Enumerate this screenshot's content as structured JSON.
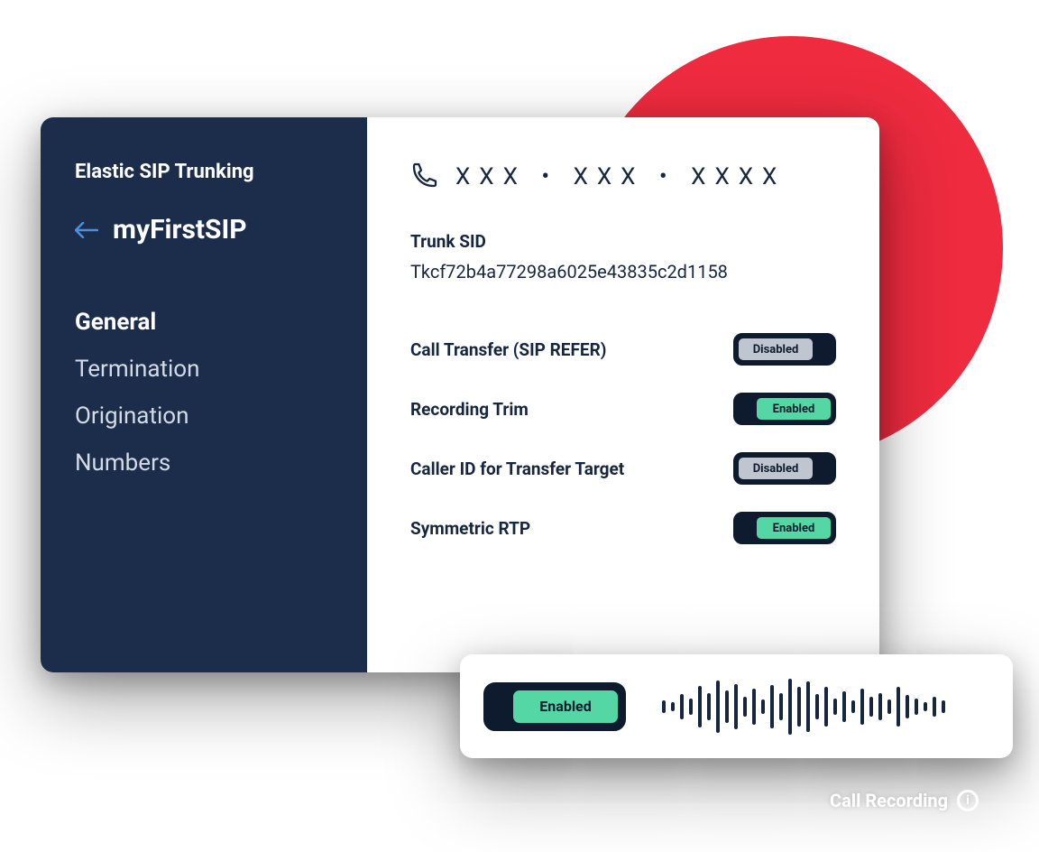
{
  "colors": {
    "accent_red": "#ee2b3f",
    "sidebar_bg": "#1b2d4a",
    "toggle_on": "#55d6a5",
    "toggle_off": "#bfc6d0",
    "text_dark": "#16263f",
    "back_arrow": "#4a90e2"
  },
  "sidebar": {
    "title": "Elastic SIP Trunking",
    "trunk_name": "myFirstSIP",
    "nav": [
      {
        "label": "General",
        "active": true
      },
      {
        "label": "Termination",
        "active": false
      },
      {
        "label": "Origination",
        "active": false
      },
      {
        "label": "Numbers",
        "active": false
      }
    ]
  },
  "main": {
    "phone_masked": "XXX • XXX • XXXX",
    "sid_label": "Trunk SID",
    "sid_value": "Tkcf72b4a77298a6025e43835c2d1158",
    "settings": [
      {
        "label": "Call Transfer (SIP REFER)",
        "state": "Disabled"
      },
      {
        "label": "Recording Trim",
        "state": "Enabled"
      },
      {
        "label": "Caller ID for Transfer Target",
        "state": "Disabled"
      },
      {
        "label": "Symmetric RTP",
        "state": "Enabled"
      }
    ]
  },
  "audio_card": {
    "toggle_state": "Enabled",
    "waveform_heights": [
      14,
      10,
      28,
      18,
      46,
      30,
      58,
      36,
      50,
      22,
      40,
      16,
      48,
      30,
      62,
      44,
      56,
      28,
      44,
      18,
      34,
      14,
      40,
      22,
      30,
      16,
      44,
      26,
      18,
      10,
      22,
      14
    ]
  },
  "footer": {
    "call_recording_label": "Call Recording"
  }
}
